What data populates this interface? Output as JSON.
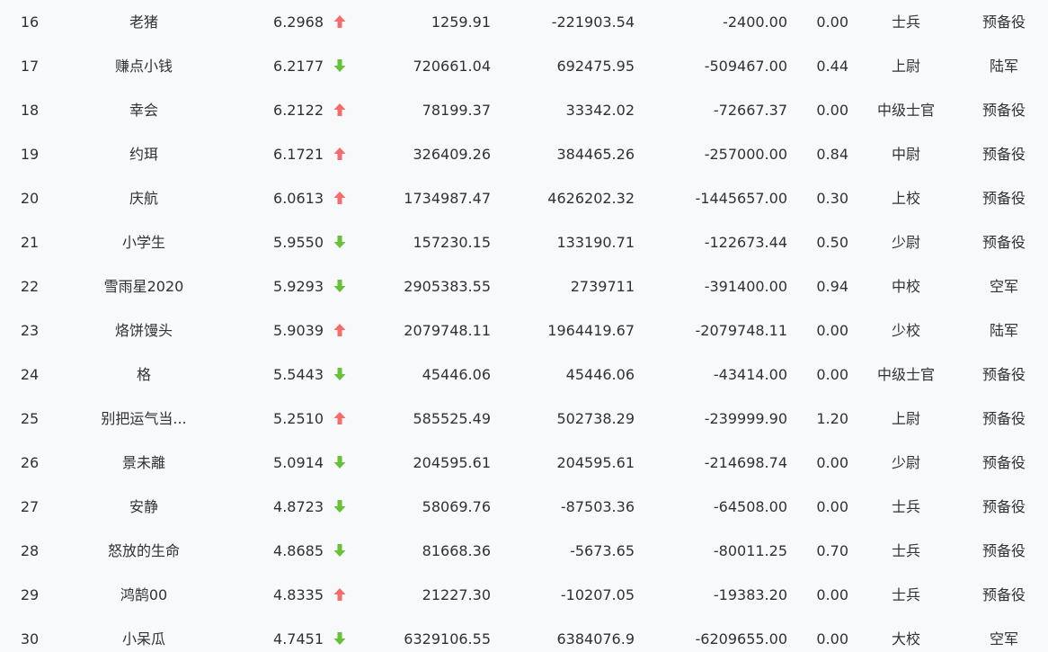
{
  "colors": {
    "up": "#f56c6c",
    "down": "#67c23a",
    "background": "#f8f9fb",
    "text": "#303133"
  },
  "rows": [
    {
      "rank": "16",
      "name": "老猪",
      "score": "6.2968",
      "trend": "up",
      "v1": "1259.91",
      "v2": "-221903.54",
      "v3": "-2400.00",
      "ratio": "0.00",
      "military_rank": "士兵",
      "branch": "预备役"
    },
    {
      "rank": "17",
      "name": "赚点小钱",
      "score": "6.2177",
      "trend": "down",
      "v1": "720661.04",
      "v2": "692475.95",
      "v3": "-509467.00",
      "ratio": "0.44",
      "military_rank": "上尉",
      "branch": "陆军"
    },
    {
      "rank": "18",
      "name": "幸会",
      "score": "6.2122",
      "trend": "up",
      "v1": "78199.37",
      "v2": "33342.02",
      "v3": "-72667.37",
      "ratio": "0.00",
      "military_rank": "中级士官",
      "branch": "预备役"
    },
    {
      "rank": "19",
      "name": "约珥",
      "score": "6.1721",
      "trend": "up",
      "v1": "326409.26",
      "v2": "384465.26",
      "v3": "-257000.00",
      "ratio": "0.84",
      "military_rank": "中尉",
      "branch": "预备役"
    },
    {
      "rank": "20",
      "name": "庆航",
      "score": "6.0613",
      "trend": "up",
      "v1": "1734987.47",
      "v2": "4626202.32",
      "v3": "-1445657.00",
      "ratio": "0.30",
      "military_rank": "上校",
      "branch": "预备役"
    },
    {
      "rank": "21",
      "name": "小学生",
      "score": "5.9550",
      "trend": "down",
      "v1": "157230.15",
      "v2": "133190.71",
      "v3": "-122673.44",
      "ratio": "0.50",
      "military_rank": "少尉",
      "branch": "预备役"
    },
    {
      "rank": "22",
      "name": "雪雨星2020",
      "score": "5.9293",
      "trend": "down",
      "v1": "2905383.55",
      "v2": "2739711",
      "v3": "-391400.00",
      "ratio": "0.94",
      "military_rank": "中校",
      "branch": "空军"
    },
    {
      "rank": "23",
      "name": "烙饼馒头",
      "score": "5.9039",
      "trend": "up",
      "v1": "2079748.11",
      "v2": "1964419.67",
      "v3": "-2079748.11",
      "ratio": "0.00",
      "military_rank": "少校",
      "branch": "陆军"
    },
    {
      "rank": "24",
      "name": "格",
      "score": "5.5443",
      "trend": "down",
      "v1": "45446.06",
      "v2": "45446.06",
      "v3": "-43414.00",
      "ratio": "0.00",
      "military_rank": "中级士官",
      "branch": "预备役"
    },
    {
      "rank": "25",
      "name": "别把运气当...",
      "score": "5.2510",
      "trend": "up",
      "v1": "585525.49",
      "v2": "502738.29",
      "v3": "-239999.90",
      "ratio": "1.20",
      "military_rank": "上尉",
      "branch": "预备役"
    },
    {
      "rank": "26",
      "name": "景未離",
      "score": "5.0914",
      "trend": "down",
      "v1": "204595.61",
      "v2": "204595.61",
      "v3": "-214698.74",
      "ratio": "0.00",
      "military_rank": "少尉",
      "branch": "预备役"
    },
    {
      "rank": "27",
      "name": "安静",
      "score": "4.8723",
      "trend": "down",
      "v1": "58069.76",
      "v2": "-87503.36",
      "v3": "-64508.00",
      "ratio": "0.00",
      "military_rank": "士兵",
      "branch": "预备役"
    },
    {
      "rank": "28",
      "name": "怒放的生命",
      "score": "4.8685",
      "trend": "down",
      "v1": "81668.36",
      "v2": "-5673.65",
      "v3": "-80011.25",
      "ratio": "0.70",
      "military_rank": "士兵",
      "branch": "预备役"
    },
    {
      "rank": "29",
      "name": "鸿鹄00",
      "score": "4.8335",
      "trend": "up",
      "v1": "21227.30",
      "v2": "-10207.05",
      "v3": "-19383.20",
      "ratio": "0.00",
      "military_rank": "士兵",
      "branch": "预备役"
    },
    {
      "rank": "30",
      "name": "小呆瓜",
      "score": "4.7451",
      "trend": "down",
      "v1": "6329106.55",
      "v2": "6384076.9",
      "v3": "-6209655.00",
      "ratio": "0.00",
      "military_rank": "大校",
      "branch": "空军"
    }
  ]
}
